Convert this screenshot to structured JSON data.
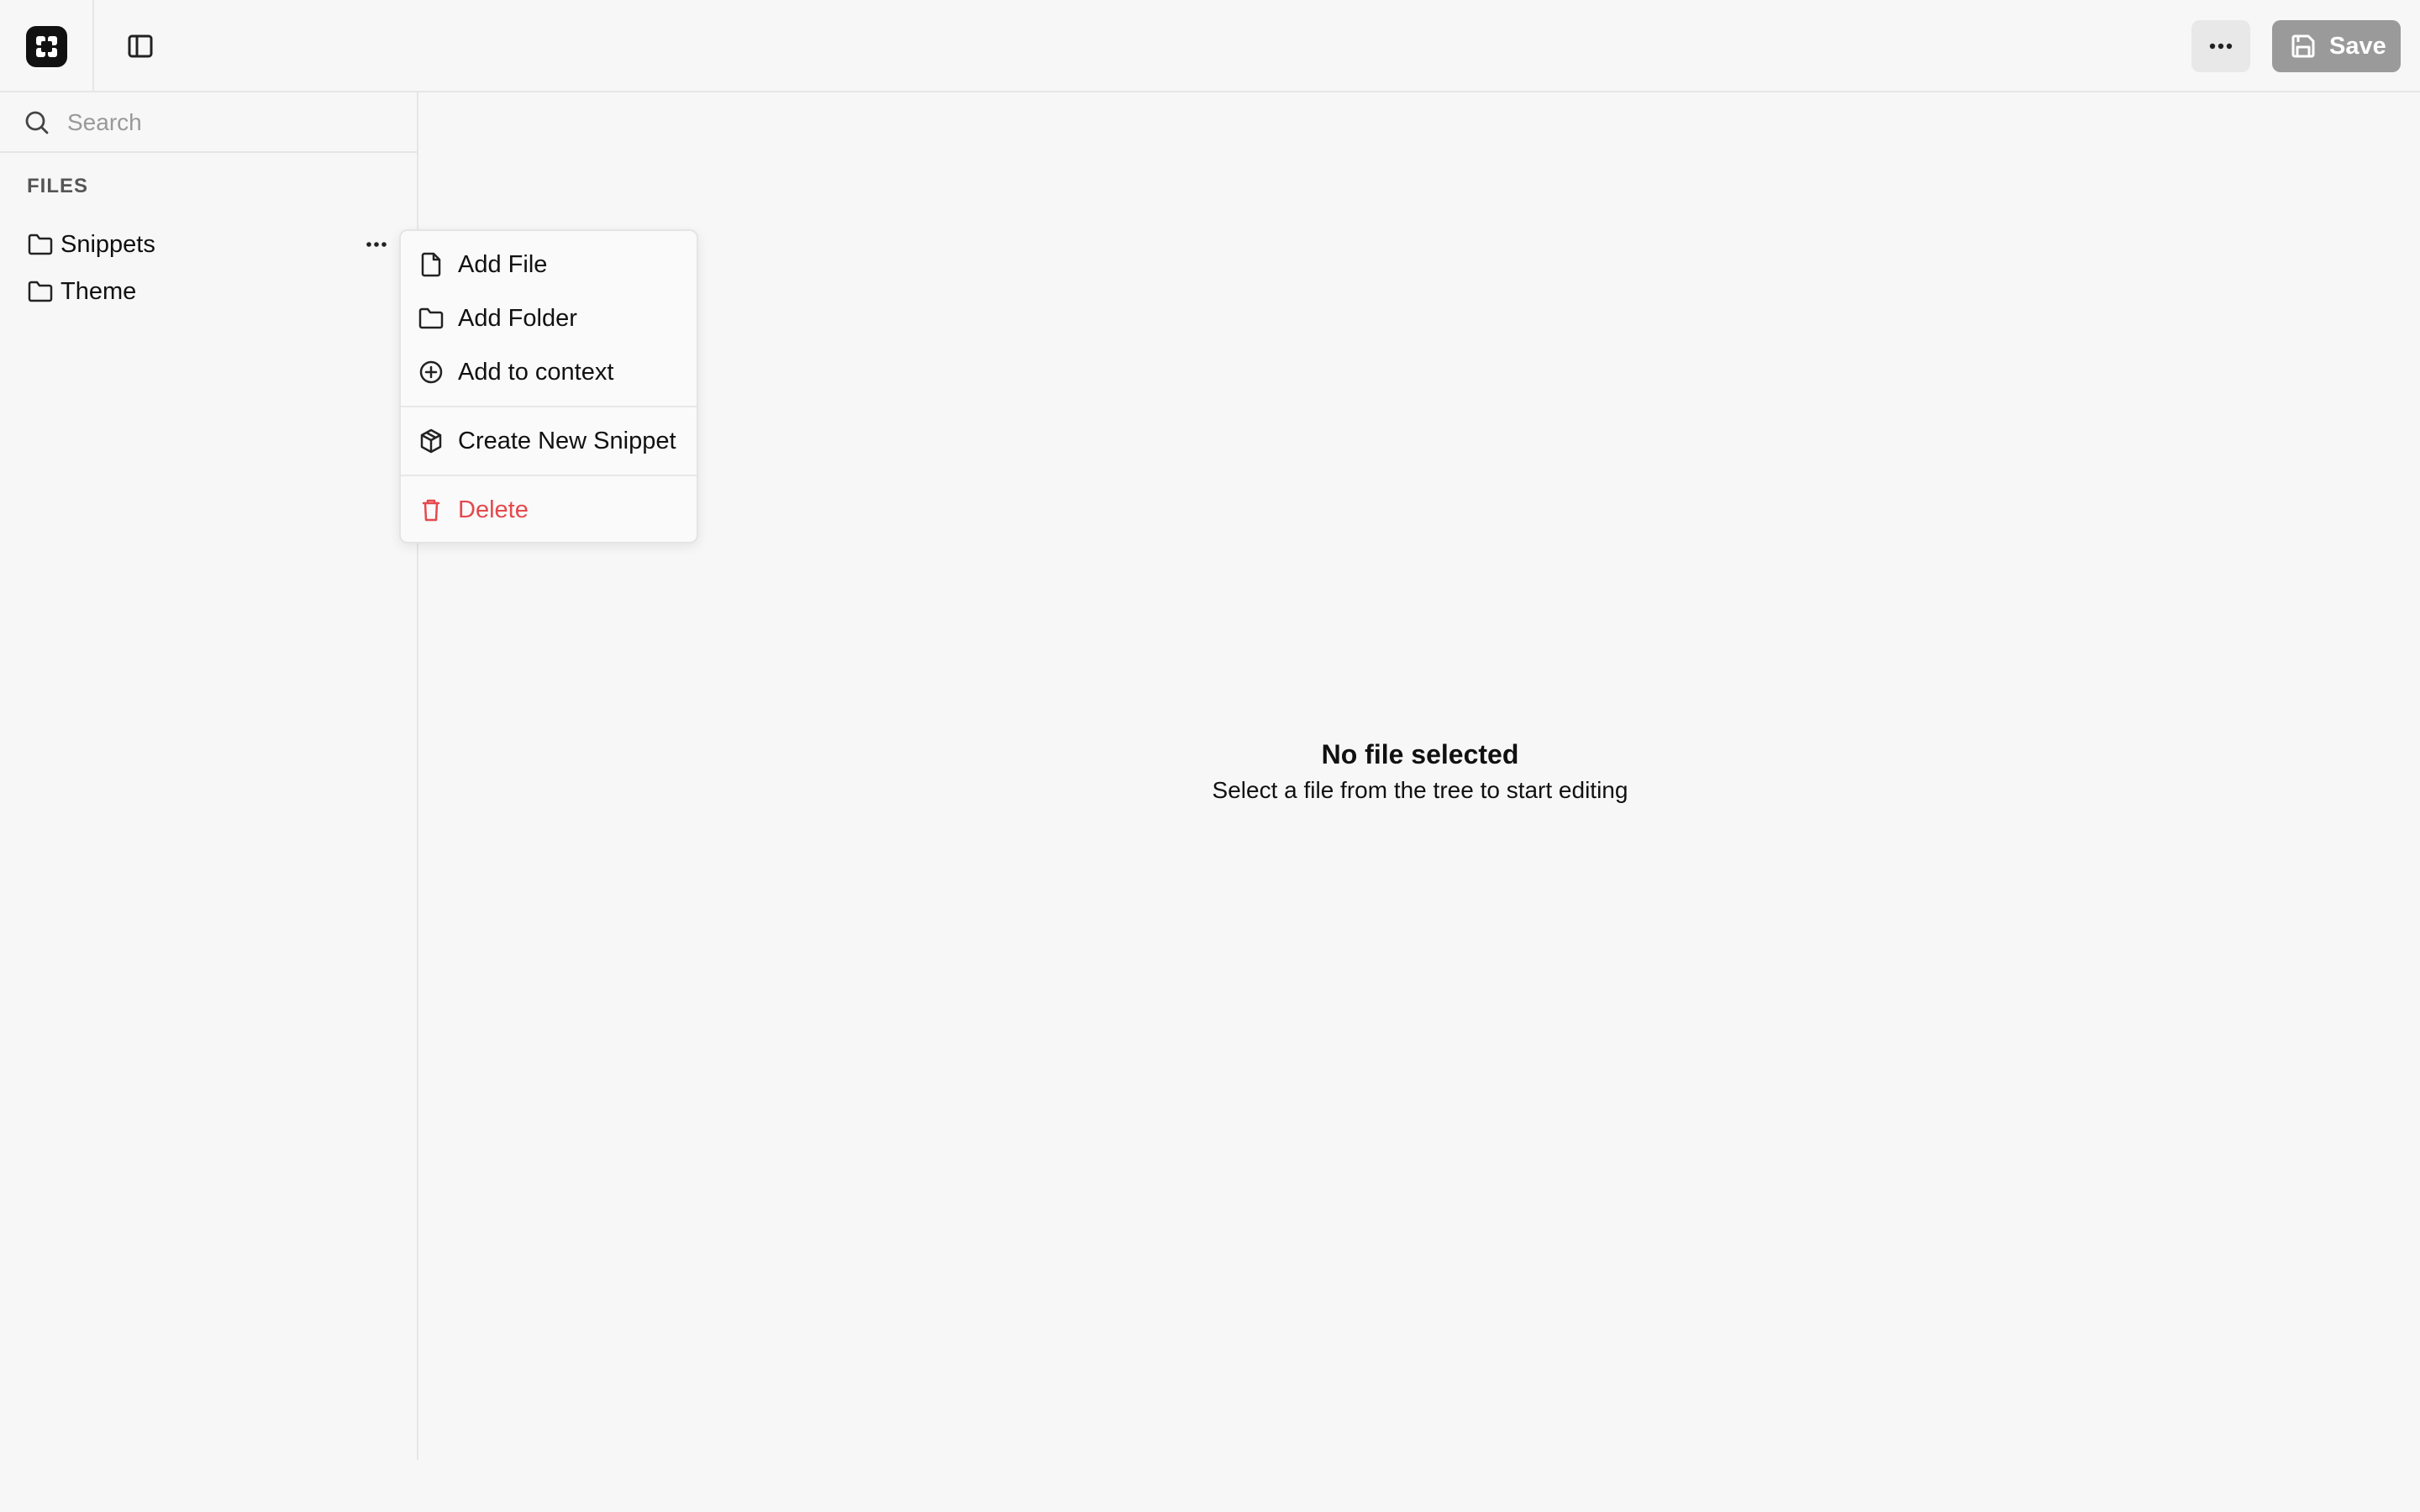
{
  "header": {
    "save_label": "Save",
    "more_icon": "ellipsis-icon",
    "toggle_icon": "sidebar-toggle-icon"
  },
  "sidebar": {
    "search_placeholder": "Search",
    "files_label": "FILES",
    "items": [
      {
        "label": "Snippets",
        "icon": "folder-icon"
      },
      {
        "label": "Theme",
        "icon": "folder-icon"
      }
    ]
  },
  "menu": {
    "items": [
      {
        "label": "Add File",
        "icon": "file-icon"
      },
      {
        "label": "Add Folder",
        "icon": "folder-icon"
      },
      {
        "label": "Add to context",
        "icon": "plus-circle-icon"
      },
      {
        "label": "Create New Snippet",
        "icon": "package-icon"
      },
      {
        "label": "Delete",
        "icon": "trash-icon"
      }
    ]
  },
  "main": {
    "empty_title": "No file selected",
    "empty_subtitle": "Select a file from the tree to start editing"
  },
  "colors": {
    "background": "#f7f7f7",
    "danger": "#e5484d",
    "save_button": "#9a9a9a"
  }
}
